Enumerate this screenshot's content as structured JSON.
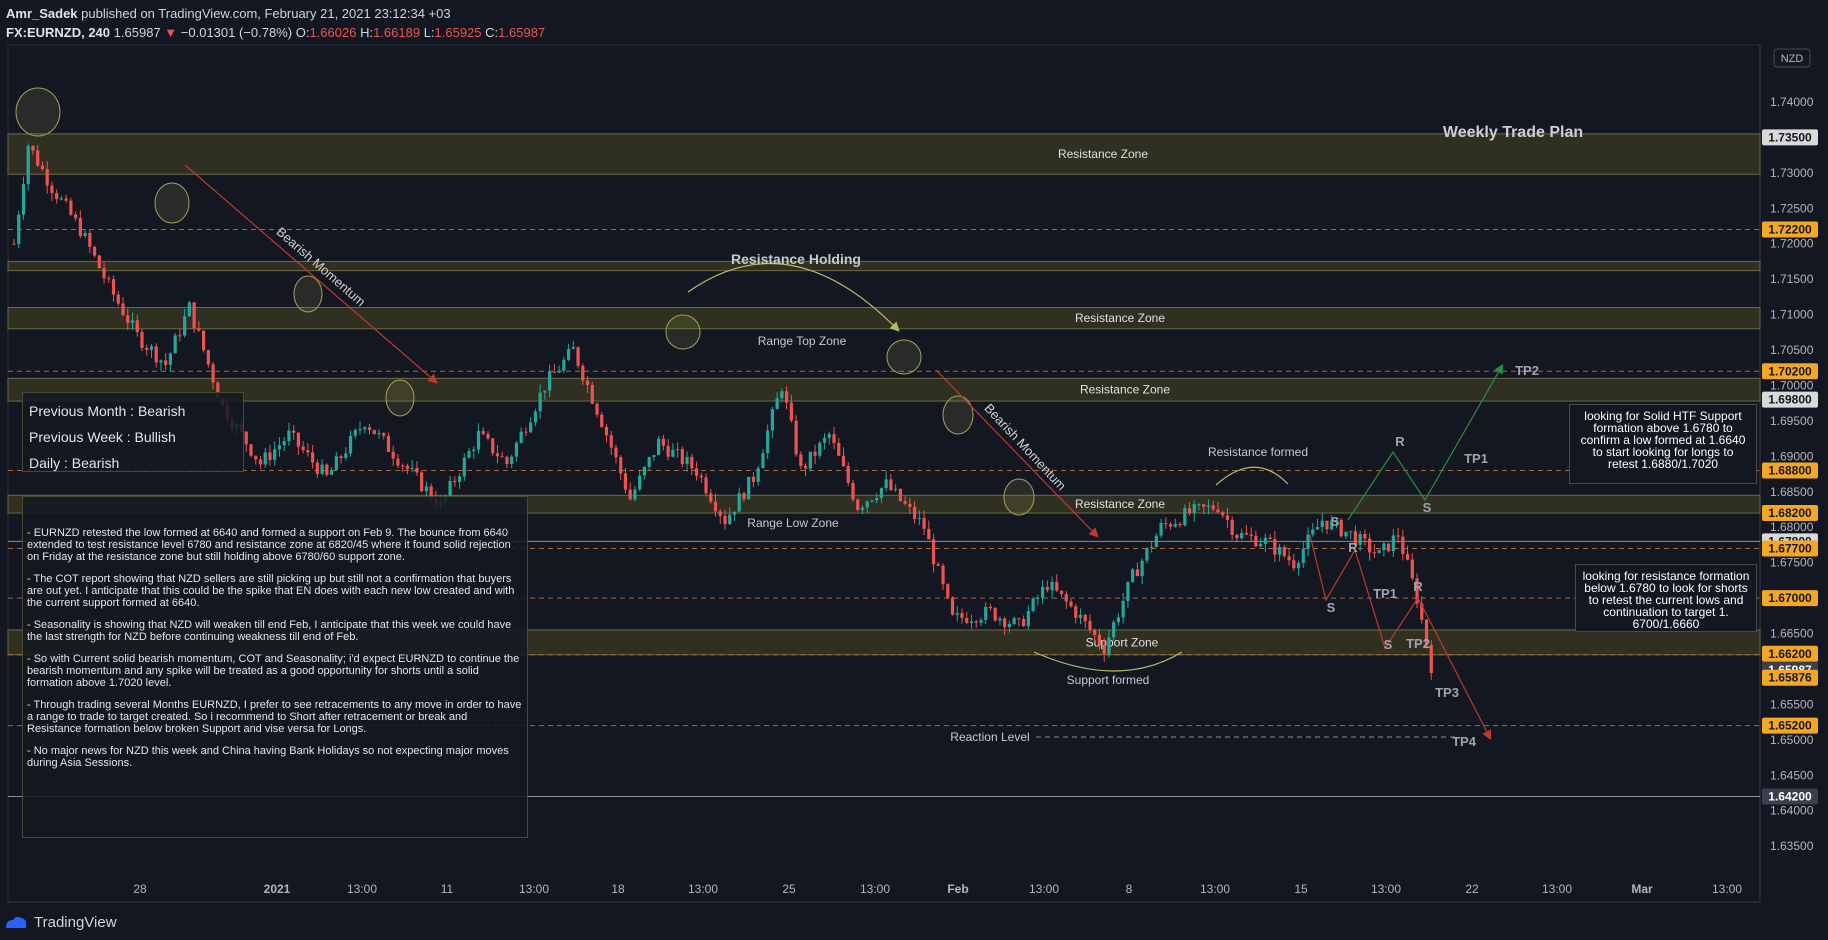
{
  "header": {
    "author": "Amr_Sadek",
    "published": "published on TradingView.com, February 21, 2021 23:12:34 +03",
    "symbol": "FX:EURNZD, 240",
    "last": "1.65987",
    "change": "−0.01301 (−0.78%)",
    "o_label": "O:",
    "o_value": "1.66026",
    "h_label": "H:",
    "h_value": "1.66189",
    "l_label": "L:",
    "l_value": "1.65925",
    "c_label": "C:",
    "c_value": "1.65987"
  },
  "footer": {
    "brand": "TradingView"
  },
  "colors": {
    "background": "#131722",
    "up": "#26a69a",
    "down": "#ef5350",
    "zone_fill": "#3a3a22",
    "zone_border": "#6b6b45",
    "badge_orange": "#f5a623",
    "badge_gray": "#d9d9d9",
    "badge_dark": "#3a3f4b",
    "bearish_arrow": "#c0392b",
    "bullish_arrow": "#2e8b3e"
  },
  "chart_data": {
    "type": "candlestick",
    "currency": "NZD",
    "ylim": [
      1.632,
      1.744
    ],
    "y_ticks": [
      "1.74000",
      "1.73000",
      "1.72500",
      "1.72000",
      "1.71500",
      "1.71000",
      "1.70500",
      "1.70000",
      "1.69500",
      "1.69000",
      "1.68500",
      "1.68000",
      "1.67500",
      "1.67000",
      "1.66500",
      "1.66000",
      "1.65500",
      "1.65000",
      "1.64500",
      "1.64000",
      "1.63500"
    ],
    "x_ticks": [
      "28",
      "2021",
      "13:00",
      "11",
      "13:00",
      "18",
      "13:00",
      "25",
      "13:00",
      "Feb",
      "13:00",
      "8",
      "13:00",
      "15",
      "13:00",
      "22",
      "13:00",
      "Mar",
      "13:00"
    ],
    "price_badges": [
      {
        "text": "1.73500",
        "style": "gray"
      },
      {
        "text": "1.72200",
        "style": "orange"
      },
      {
        "text": "1.70200",
        "style": "orange"
      },
      {
        "text": "1.69800",
        "style": "gray"
      },
      {
        "text": "1.68800",
        "style": "orange"
      },
      {
        "text": "1.68200",
        "style": "orange"
      },
      {
        "text": "1.67800",
        "style": "gray"
      },
      {
        "text": "1.67700",
        "style": "orange"
      },
      {
        "text": "1.67000",
        "style": "orange"
      },
      {
        "text": "1.66200",
        "style": "orange"
      },
      {
        "text": "1.66200",
        "style": "gray"
      },
      {
        "text": "1.65987",
        "style": "dark"
      },
      {
        "text": "1.65876",
        "style": "orange"
      },
      {
        "text": "1.65200",
        "style": "orange"
      },
      {
        "text": "1.64200",
        "style": "dark"
      }
    ],
    "zones": [
      {
        "label": "Resistance Zone",
        "top": 1.7355,
        "bottom": 1.7298
      },
      {
        "label": "",
        "top": 1.7175,
        "bottom": 1.7162
      },
      {
        "label": "Resistance Zone",
        "top": 1.711,
        "bottom": 1.708
      },
      {
        "label": "Resistance Zone",
        "top": 1.701,
        "bottom": 1.6978
      },
      {
        "label": "Resistance Zone",
        "top": 1.6845,
        "bottom": 1.682
      },
      {
        "label": "Support Zone",
        "top": 1.6655,
        "bottom": 1.662
      }
    ],
    "levels": [
      1.722,
      1.702,
      1.688,
      1.677,
      1.67,
      1.662,
      1.652
    ],
    "solid_levels": [
      1.678,
      1.642
    ],
    "series_points": [
      [
        0,
        1.72
      ],
      [
        3,
        1.734
      ],
      [
        8,
        1.728
      ],
      [
        14,
        1.722
      ],
      [
        20,
        1.714
      ],
      [
        26,
        1.707
      ],
      [
        32,
        1.703
      ],
      [
        37,
        1.711
      ],
      [
        44,
        1.697
      ],
      [
        52,
        1.689
      ],
      [
        58,
        1.693
      ],
      [
        66,
        1.687
      ],
      [
        74,
        1.695
      ],
      [
        82,
        1.689
      ],
      [
        90,
        1.683
      ],
      [
        98,
        1.693
      ],
      [
        104,
        1.689
      ],
      [
        112,
        1.7
      ],
      [
        118,
        1.705
      ],
      [
        124,
        1.695
      ],
      [
        130,
        1.684
      ],
      [
        136,
        1.692
      ],
      [
        144,
        1.688
      ],
      [
        150,
        1.681
      ],
      [
        156,
        1.687
      ],
      [
        162,
        1.7
      ],
      [
        166,
        1.688
      ],
      [
        172,
        1.693
      ],
      [
        178,
        1.683
      ],
      [
        184,
        1.686
      ],
      [
        192,
        1.68
      ],
      [
        198,
        1.667
      ],
      [
        206,
        1.668
      ],
      [
        212,
        1.666
      ],
      [
        218,
        1.672
      ],
      [
        224,
        1.668
      ],
      [
        230,
        1.663
      ],
      [
        236,
        1.673
      ],
      [
        242,
        1.68
      ],
      [
        248,
        1.682
      ],
      [
        254,
        1.683
      ],
      [
        258,
        1.679
      ],
      [
        264,
        1.678
      ],
      [
        270,
        1.675
      ],
      [
        276,
        1.681
      ],
      [
        282,
        1.679
      ],
      [
        288,
        1.676
      ],
      [
        292,
        1.679
      ],
      [
        296,
        1.67
      ],
      [
        299,
        1.6605
      ]
    ],
    "annotations": [
      "Weekly Trade Plan",
      "Resistance Holding",
      "Range Top Zone",
      "Range Low Zone",
      "Bearish Momentum",
      "Bearish Momentum",
      "Resistance formed",
      "Support formed",
      "Reaction Level",
      "TP1",
      "TP2",
      "TP1",
      "TP2",
      "TP3",
      "TP4",
      "R",
      "S",
      "R",
      "S",
      "S",
      "R",
      "S"
    ]
  },
  "sentiment": {
    "month": "Previous Month : Bearish",
    "week": "Previous Week : Bullish",
    "daily": "Daily : Bearish"
  },
  "analysis": [
    "- EURNZD retested the low formed at 6640 and formed a support on Feb 9. The bounce from 6640 extended to test resistance level 6780 and resistance zone at 6820/45 where it found solid rejection on Friday at the resistance zone but still holding above 6780/60 support zone.",
    "- The COT report showing that NZD sellers are still picking up but still not a confirmation that buyers are out yet. I anticipate that this could be the spike that EN does with each new low created and with the current support formed at 6640.",
    "-  Seasonality is showing that NZD will weaken till end Feb, I anticipate that this week we could have the last strength for NZD before continuing weakness till end of Feb.",
    "-  So with Current solid bearish momentum, COT and Seasonality; i'd expect EURNZD to continue the bearish momentum and any spike will be treated as a good opportunity for shorts until a solid formation above 1.7020 level.",
    "- Through trading several Months EURNZD, I prefer to see retracements to any move in order to have a range to trade to target created. So i recommend to Short after retracement or break and Resistance formation below broken Support and vise versa for Longs.",
    "- No major news for NZD this week and China having Bank Holidays so not expecting major moves during Asia Sessions."
  ],
  "notes": {
    "support": "looking for Solid HTF Support formation above 1.6780 to confirm a low formed at 1.6640 to start looking for longs to retest 1.6880/1.7020",
    "resistance": "looking for resistance formation below 1.6780 to look for shorts to retest the current lows and continuation to target 1. 6700/1.6660"
  }
}
